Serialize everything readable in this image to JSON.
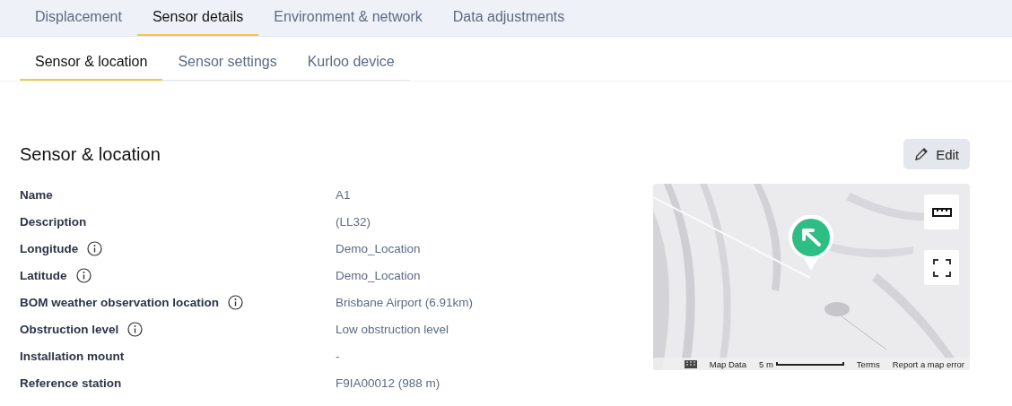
{
  "tabs": [
    {
      "label": "Displacement",
      "selected": false
    },
    {
      "label": "Sensor details",
      "selected": true
    },
    {
      "label": "Environment & network",
      "selected": false
    },
    {
      "label": "Data adjustments",
      "selected": false
    }
  ],
  "subtabs": [
    {
      "label": "Sensor & location",
      "selected": true
    },
    {
      "label": "Sensor settings",
      "selected": false
    },
    {
      "label": "Kurloo device",
      "selected": false
    }
  ],
  "section": {
    "title": "Sensor & location",
    "edit_button": "Edit"
  },
  "fields": [
    {
      "label": "Name",
      "value": "A1",
      "info": false
    },
    {
      "label": "Description",
      "value": "(LL32)",
      "info": false
    },
    {
      "label": "Longitude",
      "value": "Demo_Location",
      "info": true
    },
    {
      "label": "Latitude",
      "value": "Demo_Location",
      "info": true
    },
    {
      "label": "BOM weather observation location",
      "value": "Brisbane Airport (6.91km)",
      "info": true
    },
    {
      "label": "Obstruction level",
      "value": "Low obstruction level",
      "info": true
    },
    {
      "label": "Installation mount",
      "value": "-",
      "info": false
    },
    {
      "label": "Reference station",
      "value": "F9IA00012 (988 m)",
      "info": false
    }
  ],
  "map": {
    "attribution": [
      "Map Data",
      "5 m",
      "Terms",
      "Report a map error"
    ]
  }
}
